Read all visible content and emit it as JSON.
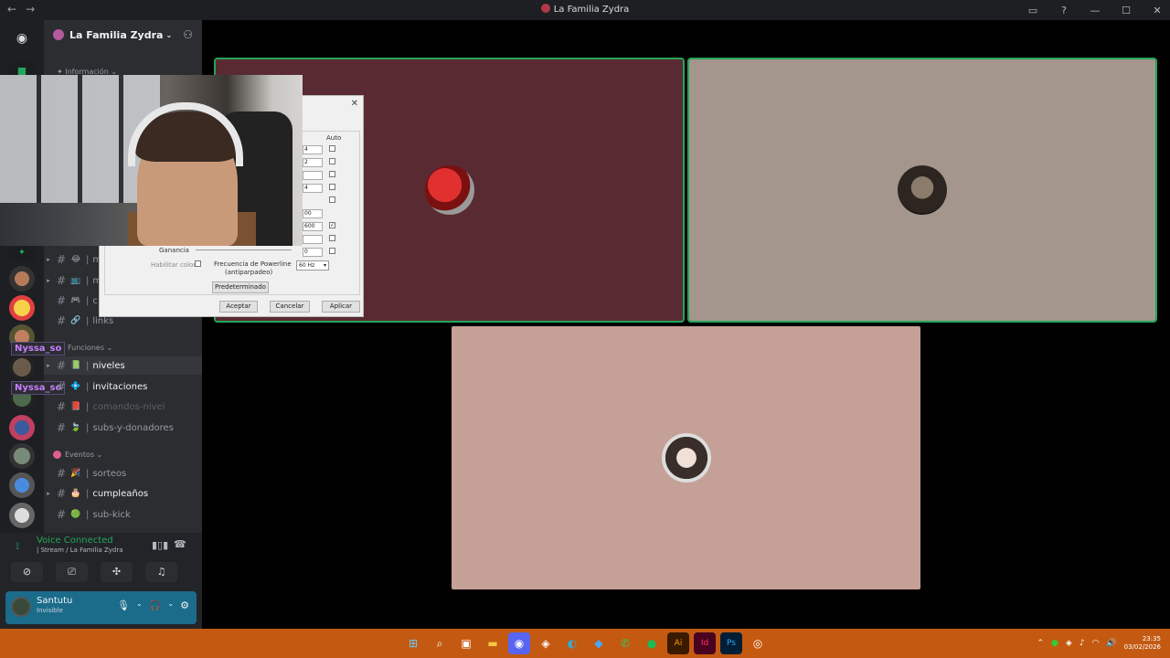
{
  "window": {
    "title": "La Familia Zydra",
    "nav_back": "←",
    "nav_forward": "→",
    "controls": [
      "▭",
      "?",
      "—",
      "☐",
      "✕"
    ]
  },
  "guild": {
    "name": "La Familia Zydra",
    "info_tag": "✦ Información ⌄"
  },
  "channels": [
    {
      "label": "m",
      "emoji": "😂",
      "state": "normal"
    },
    {
      "label": "m",
      "emoji": "📺",
      "state": "normal"
    },
    {
      "label": "c",
      "emoji": "🎮",
      "state": "normal"
    },
    {
      "label": "links",
      "emoji": "🔗",
      "state": "normal"
    }
  ],
  "category_funciones": "Funciones ⌄",
  "channels_funciones": [
    {
      "label": "niveles",
      "emoji": "📗",
      "state": "active"
    },
    {
      "label": "invitaciones",
      "emoji": "💠",
      "state": "unread"
    },
    {
      "label": "comandos-nivel",
      "emoji": "📕",
      "state": "muted"
    },
    {
      "label": "subs-y-donadores",
      "emoji": "🍃",
      "state": "normal"
    }
  ],
  "category_eventos": "Eventos ⌄",
  "channels_eventos": [
    {
      "label": "sorteos",
      "emoji": "🎉",
      "state": "normal"
    },
    {
      "label": "cumpleaños",
      "emoji": "🎂",
      "state": "unread"
    },
    {
      "label": "sub-kick",
      "emoji": "🟢",
      "state": "normal"
    }
  ],
  "nyssa_tags": [
    "Nyssa_so",
    "Nyssa_so"
  ],
  "voice": {
    "status": "Voice Connected",
    "sub": "| Stream / La Familia Zydra"
  },
  "user": {
    "name": "Santutu",
    "status": "Invisible"
  },
  "dialog": {
    "close": "✕",
    "auto_label": "Auto",
    "fields": [
      "4",
      "2",
      "",
      "4",
      "00",
      "600",
      "",
      "0"
    ],
    "checks": [
      "",
      "",
      "",
      "",
      "",
      "✓",
      "",
      ""
    ],
    "gain_label": "Ganancia",
    "color_label": "Habilitar color",
    "powerline_label": "Frecuencia de Powerline",
    "powerline_sub": "(antiparpadeo)",
    "powerline_value": "60 Hz",
    "default_btn": "Predeterminado",
    "ok_btn": "Aceptar",
    "cancel_btn": "Cancelar",
    "apply_btn": "Aplicar"
  },
  "taskbar": {
    "time": "23:35",
    "date": "03/02/2026"
  },
  "colors": {
    "tile1": "#5a2a33",
    "tile2": "#a4968d",
    "tile3": "#c5a097",
    "speaking": "#23a55a",
    "taskbar": "#c45a12",
    "userbar": "#1a6c8a"
  }
}
